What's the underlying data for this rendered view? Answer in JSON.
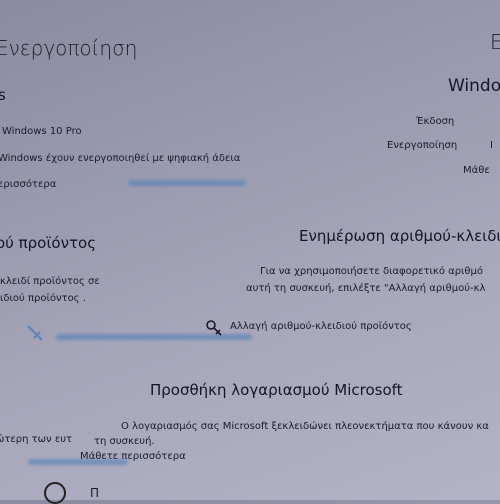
{
  "left_column": {
    "title": "Ενεργοποίηση",
    "section_label": "s",
    "edition_value": "Windows 10 Pro",
    "activation_text": "Windows έχουν ενεργοποιηθεί με ψηφιακή άδεια",
    "learn_more": "ερισσότερα",
    "product_key_heading": "ού προϊόντος",
    "product_key_text_1": "κλειδί προϊόντος σε",
    "product_key_text_2": "ιδιού προϊόντος .",
    "bottom_text": "ώτερη των ευτ",
    "bottom_partial_button": "Π"
  },
  "right_column": {
    "windows_heading": "Windo",
    "edition_label": "Έκδοση",
    "activation_label": "Ενεργοποίηση",
    "activation_value_partial": "Ι",
    "learn_more_partial": "Μάθε"
  },
  "update_key": {
    "heading": "Ενημέρωση αριθμού-κλειδι",
    "text_1": "Για να χρησιμοποιήσετε διαφορετικό αριθμό",
    "text_2": "αυτή τη συσκευή, επιλέξτε \"Αλλαγή αριθμού-κλ",
    "change_key_link": "Αλλαγή αριθμού-κλειδιού προϊόντος"
  },
  "microsoft_account": {
    "heading": "Προσθήκη λογαριασμού Microsoft",
    "text_1": "Ο λογαριασμός σας Microsoft ξεκλειδώνει πλεονεκτήματα που κάνουν κα",
    "text_2": "τη συσκευή.",
    "learn_more": "Μάθετε περισσότερα"
  },
  "colors": {
    "background": "#9a9bb0",
    "link": "#2f6aa6",
    "text": "#1a1a2c"
  },
  "icons": [
    "key-change-icon",
    "external-link-icon"
  ]
}
